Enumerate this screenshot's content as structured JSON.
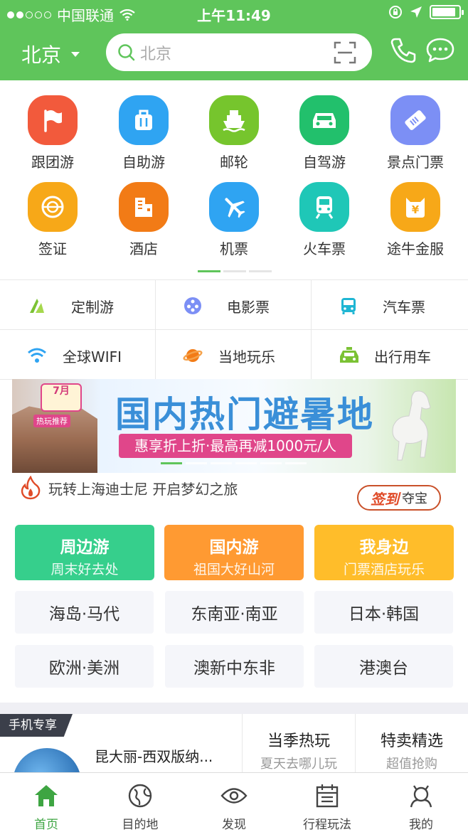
{
  "status_bar": {
    "carrier": "中国联通",
    "time": "上午11:49",
    "battery_level": 0.9
  },
  "header": {
    "city": "北京",
    "search_placeholder": "北京"
  },
  "main_grid": [
    {
      "label": "跟团游",
      "icon": "flag-icon",
      "color": "#f25a3c"
    },
    {
      "label": "自助游",
      "icon": "luggage-icon",
      "color": "#2fa4f2"
    },
    {
      "label": "邮轮",
      "icon": "ship-icon",
      "color": "#76c52d"
    },
    {
      "label": "自驾游",
      "icon": "car-icon",
      "color": "#22c06c"
    },
    {
      "label": "景点门票",
      "icon": "ticket-icon",
      "color": "#7c8ff5"
    },
    {
      "label": "签证",
      "icon": "visa-icon",
      "color": "#f7a818"
    },
    {
      "label": "酒店",
      "icon": "hotel-icon",
      "color": "#f27b16"
    },
    {
      "label": "机票",
      "icon": "plane-icon",
      "color": "#2fa4f2"
    },
    {
      "label": "火车票",
      "icon": "train-icon",
      "color": "#1fc7b7"
    },
    {
      "label": "途牛金服",
      "icon": "piggy-bank-icon",
      "color": "#f7a818"
    }
  ],
  "sub_grid": [
    {
      "label": "定制游",
      "icon": "custom-tour-icon",
      "color": "#7bc234"
    },
    {
      "label": "电影票",
      "icon": "film-reel-icon",
      "color": "#7c8ff5"
    },
    {
      "label": "汽车票",
      "icon": "bus-icon",
      "color": "#1fb6d3"
    },
    {
      "label": "全球WIFI",
      "icon": "wifi-icon",
      "color": "#2fa4f2"
    },
    {
      "label": "当地玩乐",
      "icon": "planet-icon",
      "color": "#f27b16"
    },
    {
      "label": "出行用车",
      "icon": "taxi-icon",
      "color": "#7bc234"
    }
  ],
  "banner": {
    "title": "国内热门避暑地",
    "subtitle": "惠享折上折·最高再减1000元/人",
    "badge": "7月",
    "badge_sub": "热玩推荐"
  },
  "notice": {
    "text": "玩转上海迪士尼  开启梦幻之旅"
  },
  "sign_in": {
    "part1": "签到",
    "part2": "夺宝"
  },
  "tiles": [
    {
      "title": "周边游",
      "subtitle": "周末好去处",
      "color": "#36cf8c"
    },
    {
      "title": "国内游",
      "subtitle": "祖国大好山河",
      "color": "#ff9a32"
    },
    {
      "title": "我身边",
      "subtitle": "门票酒店玩乐",
      "color": "#ffbd2a"
    }
  ],
  "destinations": [
    "海岛·马代",
    "东南亚·南亚",
    "日本·韩国",
    "欧洲·美洲",
    "澳新中东非",
    "港澳台"
  ],
  "promo": {
    "tag": "手机专享",
    "title": "昆大丽-西双版纳...",
    "col1": {
      "title": "当季热玩",
      "sub": "夏天去哪儿玩"
    },
    "col2": {
      "title": "特卖精选",
      "sub": "超值抢购"
    }
  },
  "tabbar": [
    {
      "label": "首页",
      "icon": "home-icon",
      "active": true
    },
    {
      "label": "目的地",
      "icon": "globe-icon",
      "active": false
    },
    {
      "label": "发现",
      "icon": "eye-icon",
      "active": false
    },
    {
      "label": "行程玩法",
      "icon": "calendar-icon",
      "active": false
    },
    {
      "label": "我的",
      "icon": "user-icon",
      "active": false
    }
  ]
}
